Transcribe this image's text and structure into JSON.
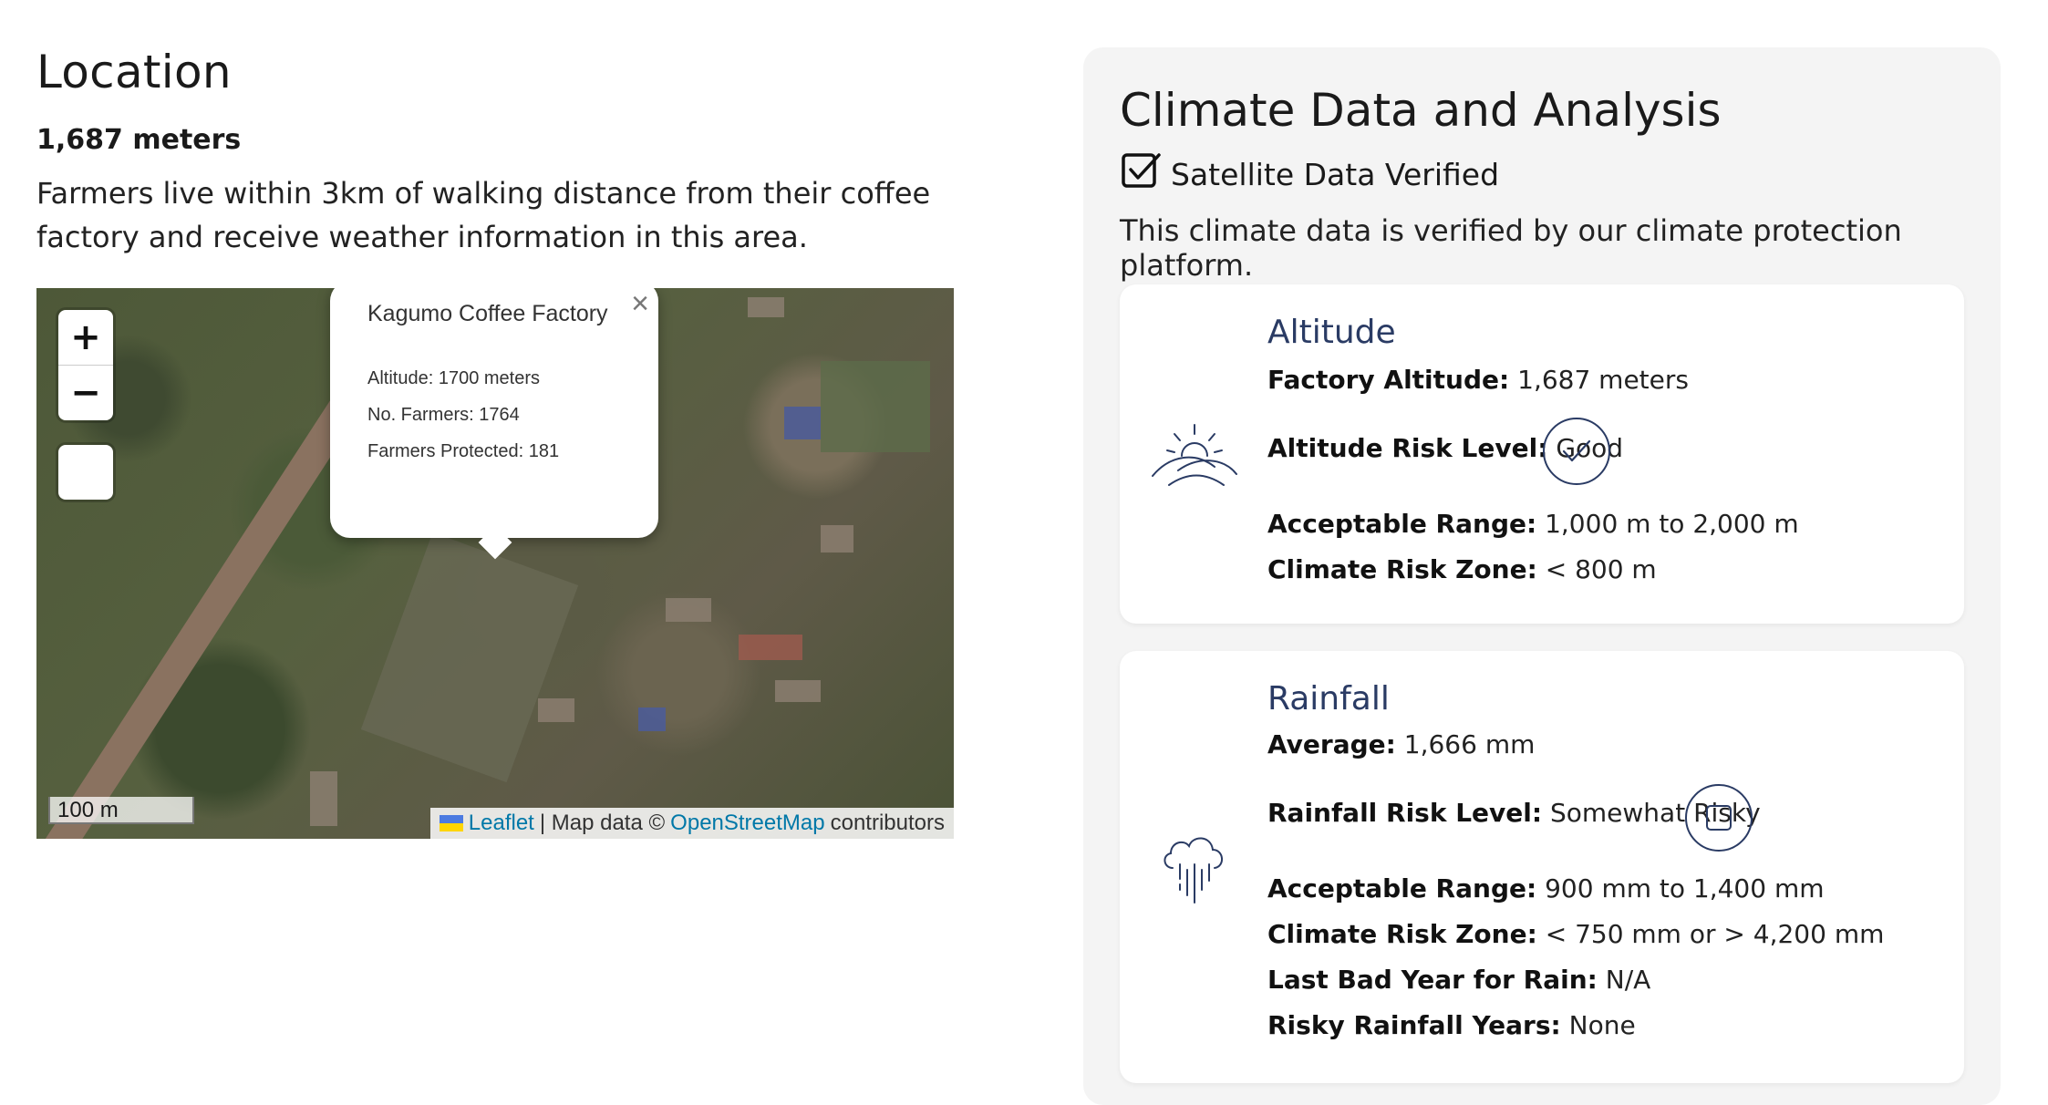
{
  "location": {
    "title": "Location",
    "altitude": "1,687 meters",
    "description": "Farmers live within 3km of walking distance from their coffee factory and receive weather information in this area."
  },
  "map": {
    "zoom_in": "+",
    "zoom_out": "−",
    "popup": {
      "title": "Kagumo Coffee Factory",
      "close": "×",
      "altitude": "Altitude: 1700 meters",
      "farmers": "No. Farmers: 1764",
      "protected": "Farmers Protected: 181"
    },
    "scale": "100 m",
    "attribution": {
      "leaflet": "Leaflet",
      "sep": "| Map data ©",
      "osm": "OpenStreetMap",
      "contrib": "contributors"
    }
  },
  "climate": {
    "title": "Climate Data and Analysis",
    "verified": "Satellite Data Verified",
    "description": "This climate data is verified by our climate protection platform.",
    "altitude_card": {
      "title": "Altitude",
      "factory_label": "Factory Altitude:",
      "factory_value": "1,687 meters",
      "risk_label": "Altitude Risk Level:",
      "risk_value": "Good",
      "range_label": "Acceptable Range:",
      "range_value": "1,000 m to 2,000 m",
      "zone_label": "Climate Risk Zone:",
      "zone_value": "< 800 m"
    },
    "rainfall_card": {
      "title": "Rainfall",
      "avg_label": "Average:",
      "avg_value": "1,666 mm",
      "risk_label": "Rainfall Risk Level:",
      "risk_value": "Somewhat Risky",
      "range_label": "Acceptable Range:",
      "range_value": "900 mm to 1,400 mm",
      "zone_label": "Climate Risk Zone:",
      "zone_value": "< 750 mm or > 4,200 mm",
      "badyear_label": "Last Bad Year for Rain:",
      "badyear_value": "N/A",
      "riskyyears_label": "Risky Rainfall Years:",
      "riskyyears_value": "None"
    }
  },
  "colors": {
    "accent": "#2a3b64",
    "link": "#0078a8",
    "panel_bg": "#f4f4f4"
  }
}
